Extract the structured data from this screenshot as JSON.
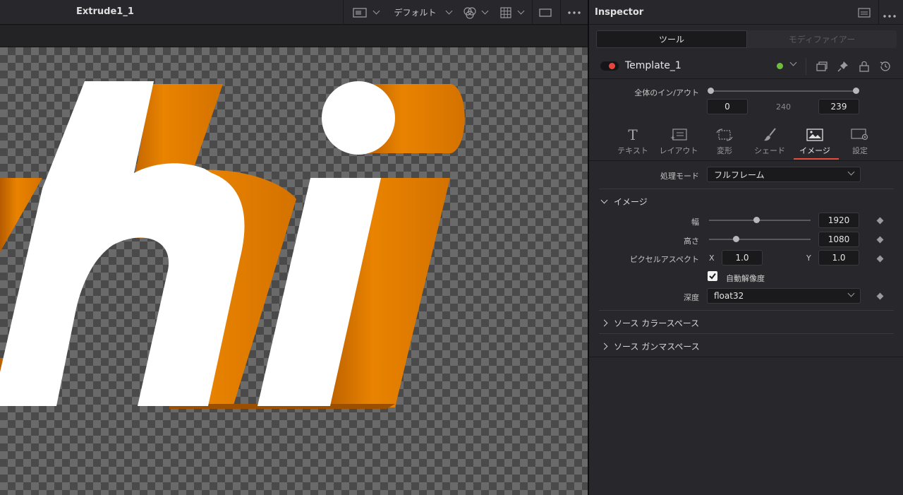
{
  "viewer": {
    "title": "Extrude1_1",
    "display_mode": "デフォルト",
    "canvas_text": "hi",
    "colors": {
      "extrude": "#e07a00",
      "face": "#ffffff"
    }
  },
  "inspector": {
    "title": "Inspector",
    "tabs": [
      {
        "label": "ツール",
        "active": true
      },
      {
        "label": "モディファイアー",
        "active": false
      }
    ],
    "node": {
      "name": "Template_1",
      "enabled": true
    },
    "in_out": {
      "label": "全体のイン/アウト",
      "start": "0",
      "mid": "240",
      "end": "239"
    },
    "func_tabs": [
      {
        "label": "テキスト",
        "icon": "text-icon"
      },
      {
        "label": "レイアウト",
        "icon": "layout-icon"
      },
      {
        "label": "変形",
        "icon": "transform-icon"
      },
      {
        "label": "シェード",
        "icon": "brush-icon"
      },
      {
        "label": "イメージ",
        "icon": "image-icon",
        "active": true
      },
      {
        "label": "設定",
        "icon": "settings-icon"
      }
    ],
    "processing_mode": {
      "label": "処理モード",
      "value": "フルフレーム"
    },
    "image_section": {
      "title": "イメージ",
      "width": {
        "label": "幅",
        "value": "1920"
      },
      "height": {
        "label": "高さ",
        "value": "1080"
      },
      "pixel_aspect": {
        "label": "ピクセルアスペクト",
        "x_label": "X",
        "x": "1.0",
        "y_label": "Y",
        "y": "1.0"
      },
      "auto_resolution": {
        "label": "自動解像度",
        "checked": true
      },
      "depth": {
        "label": "深度",
        "value": "float32"
      }
    },
    "source_color_space": "ソース カラースペース",
    "source_gamma_space": "ソース ガンマスペース"
  }
}
